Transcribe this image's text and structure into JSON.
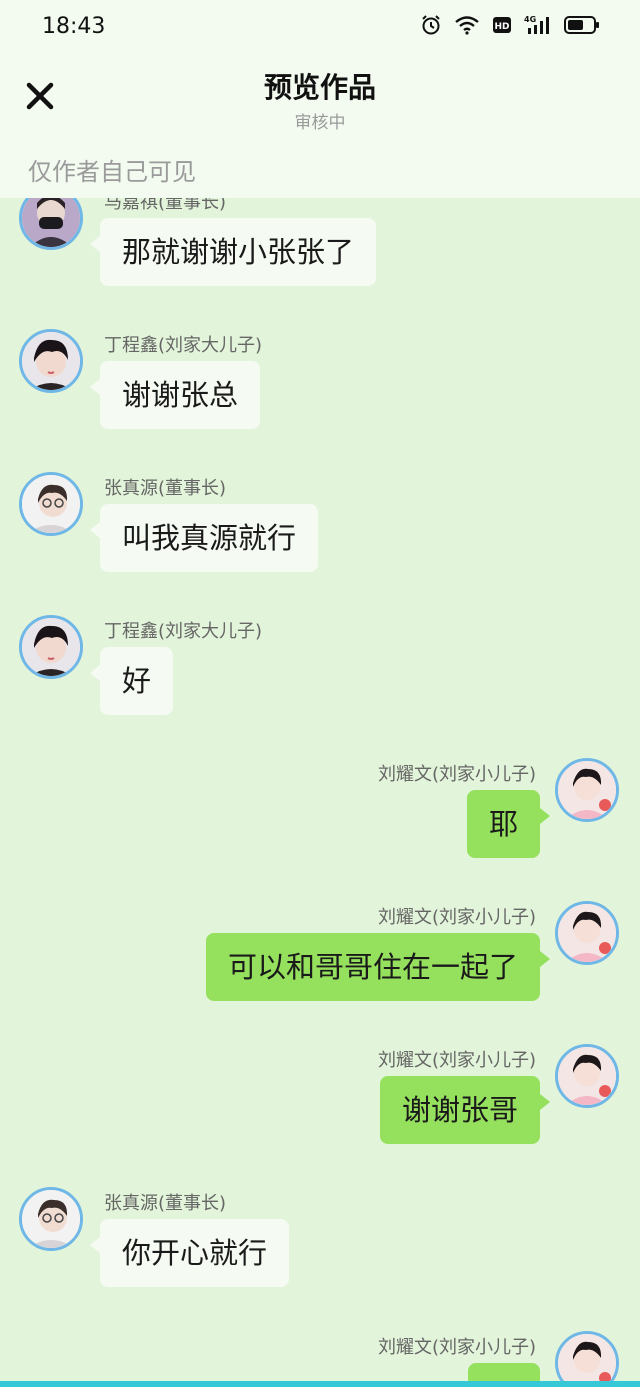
{
  "status_bar": {
    "time": "18:43"
  },
  "header": {
    "title": "预览作品",
    "subtitle": "审核中",
    "visibility_note": "仅作者自己可见"
  },
  "messages": [
    {
      "side": "left",
      "name": "马嘉祺(董事长)",
      "text": "那就谢谢小张张了",
      "avatar": "person-mask-avatar"
    },
    {
      "side": "left",
      "name": "丁程鑫(刘家大儿子)",
      "text": "谢谢张总",
      "avatar": "person-dark-hair-avatar"
    },
    {
      "side": "left",
      "name": "张真源(董事长)",
      "text": "叫我真源就行",
      "avatar": "person-glasses-avatar"
    },
    {
      "side": "left",
      "name": "丁程鑫(刘家大儿子)",
      "text": "好",
      "avatar": "person-dark-hair-avatar"
    },
    {
      "side": "right",
      "name": "刘耀文(刘家小儿子)",
      "text": "耶",
      "avatar": "person-pink-avatar"
    },
    {
      "side": "right",
      "name": "刘耀文(刘家小儿子)",
      "text": "可以和哥哥住在一起了",
      "avatar": "person-pink-avatar"
    },
    {
      "side": "right",
      "name": "刘耀文(刘家小儿子)",
      "text": "谢谢张哥",
      "avatar": "person-pink-avatar"
    },
    {
      "side": "left",
      "name": "张真源(董事长)",
      "text": "你开心就行",
      "avatar": "person-glasses-avatar"
    },
    {
      "side": "right",
      "name": "刘耀文(刘家小儿子)",
      "text": "",
      "avatar": "person-pink-avatar"
    }
  ],
  "colors": {
    "background": "#e2f4d9",
    "header_bg": "#f3fbf0",
    "left_bubble": "#f5fbf2",
    "right_bubble": "#95e05d",
    "avatar_ring": "#6fb7e6"
  }
}
